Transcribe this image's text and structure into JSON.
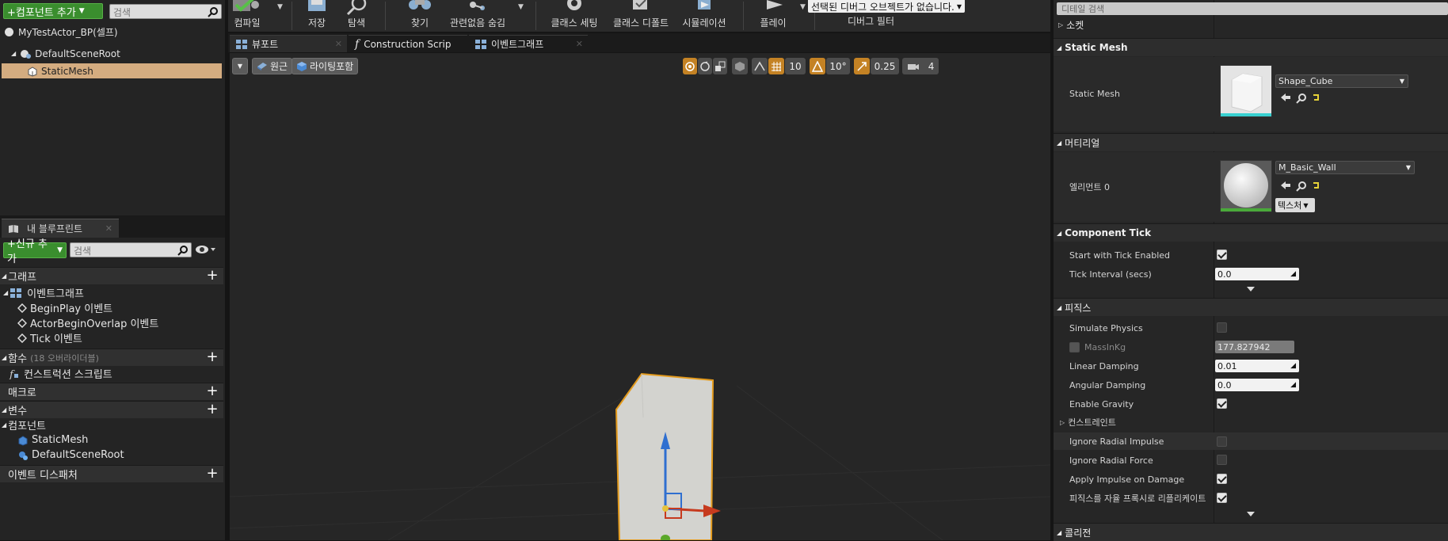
{
  "components": {
    "add_button": "+컴포넌트 추가",
    "search_placeholder": "검색",
    "tree": [
      {
        "label": "MyTestActor_BP(셀프)"
      },
      {
        "label": "DefaultSceneRoot"
      },
      {
        "label": "StaticMesh"
      }
    ]
  },
  "my_blueprint": {
    "tab_label": "내 블루프린트",
    "add_new": "+신규 추가",
    "search_placeholder": "검색",
    "sections": {
      "graph": "그래프",
      "functions": "함수",
      "functions_note": "(18 오버라이더블)",
      "macros": "매크로",
      "variables": "변수",
      "event_dispatchers": "이벤트 디스패처"
    },
    "event_graph": "이벤트그래프",
    "events": [
      "BeginPlay 이벤트",
      "ActorBeginOverlap 이벤트",
      "Tick 이벤트"
    ],
    "construction_script": "컨스트럭션 스크립트",
    "components_category": "컴포넌트",
    "variables": [
      "StaticMesh",
      "DefaultSceneRoot"
    ]
  },
  "toolbar": {
    "compile": "컴파일",
    "save": "저장",
    "browse": "탐색",
    "find": "찾기",
    "hide_unrelated": "관련없음 숨김",
    "class_settings": "클래스 세팅",
    "class_defaults": "클래스 디폴트",
    "simulation": "시뮬레이션",
    "play": "플레이",
    "debug_select": "선택된 디버그 오브젝트가 없습니다.",
    "debug_filter": "디버그 필터"
  },
  "tabs": [
    {
      "label": "뷰포트"
    },
    {
      "label": "Construction Scrip"
    },
    {
      "label": "이벤트그래프"
    }
  ],
  "viewport": {
    "perspective": "원근",
    "lit": "라이팅포함",
    "grid_snap": "10",
    "rotation_snap": "10°",
    "scale_snap": "0.25",
    "camera_speed": "4"
  },
  "details": {
    "search_placeholder": "디테일 검색",
    "sockets": "소켓",
    "static_mesh_section": "Static Mesh",
    "static_mesh_label": "Static Mesh",
    "static_mesh_value": "Shape_Cube",
    "materials_section": "머티리얼",
    "element0_label": "엘리먼트 0",
    "element0_value": "M_Basic_Wall",
    "textures_button": "텍스처",
    "component_tick_section": "Component Tick",
    "start_with_tick": "Start with Tick Enabled",
    "tick_interval": "Tick Interval (secs)",
    "tick_interval_value": "0.0",
    "physics_section": "피직스",
    "simulate_physics": "Simulate Physics",
    "mass_in_kg": "MassInKg",
    "mass_value": "177.827942",
    "linear_damping": "Linear Damping",
    "linear_damping_value": "0.01",
    "angular_damping": "Angular Damping",
    "angular_damping_value": "0.0",
    "enable_gravity": "Enable Gravity",
    "constraints": "컨스트레인트",
    "ignore_radial_impulse": "Ignore Radial Impulse",
    "ignore_radial_force": "Ignore Radial Force",
    "apply_impulse_on_damage": "Apply Impulse on Damage",
    "replicate_physics_to_autonomous": "피직스를 자율 프록시로 리플리케이트",
    "collision_section": "콜리전"
  },
  "colors": {
    "accent_green": "#3a8e2e",
    "selection": "#d4ac80",
    "orange": "#c48224"
  }
}
